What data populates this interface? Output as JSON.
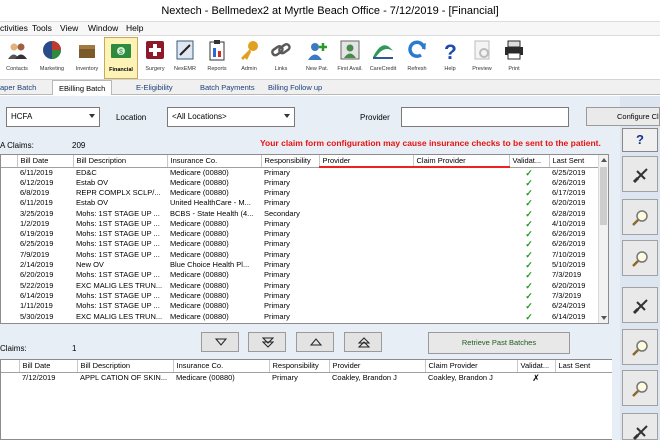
{
  "window": {
    "title": "Nextech - Bellmedex2 at Myrtle Beach Office - 7/12/2019 - [Financial]"
  },
  "menu": [
    "ctivities",
    "Tools",
    "View",
    "Window",
    "Help"
  ],
  "toolbar": [
    {
      "label": "Patients",
      "icon": "patients-icon",
      "color": "#3a6bb0"
    },
    {
      "label": "Contacts",
      "icon": "contacts-icon",
      "color": "#4a4a4a"
    },
    {
      "label": "Marketing",
      "icon": "marketing-pie-icon",
      "color": "#c0392b"
    },
    {
      "label": "Inventory",
      "icon": "inventory-icon",
      "color": "#7a5a2a"
    },
    {
      "label": "Financial",
      "icon": "financial-money-icon",
      "color": "#2e8b3e",
      "active": true
    },
    {
      "label": "Surgery",
      "icon": "surgery-cross-icon",
      "color": "#8c1a2a"
    },
    {
      "label": "NexEMR",
      "icon": "nexemr-icon",
      "color": "#3a5a7a"
    },
    {
      "label": "Reports",
      "icon": "reports-clipboard-icon",
      "color": "#2a4a9a"
    },
    {
      "label": "Admin",
      "icon": "admin-key-icon",
      "color": "#e0a020"
    },
    {
      "label": "Links",
      "icon": "links-chain-icon",
      "color": "#5a5a5a"
    },
    {
      "label": "New Pat.",
      "icon": "new-patient-icon",
      "color": "#3a7ac0"
    },
    {
      "label": "First Avail.",
      "icon": "first-available-icon",
      "color": "#4a8a4a"
    },
    {
      "label": "CareCredit",
      "icon": "carecredit-icon",
      "color": "#2e9a5a"
    },
    {
      "label": "Refresh",
      "icon": "refresh-icon",
      "color": "#2a7ad0"
    },
    {
      "label": "Help",
      "icon": "help-icon",
      "color": "#1a4ab0"
    },
    {
      "label": "Preview",
      "icon": "preview-icon",
      "color": "#bbbbbb"
    },
    {
      "label": "Print",
      "icon": "print-icon",
      "color": "#2a2a2a"
    }
  ],
  "subtabs": [
    "aper Batch",
    "EBilling Batch",
    "E-Eligibility",
    "Batch Payments",
    "Billing Follow up"
  ],
  "filters": {
    "form": "HCFA",
    "location_label": "Location",
    "location": "<All Locations>",
    "provider_label": "Provider",
    "provider": "",
    "configure": "Configure Claim"
  },
  "warning": "Your claim form configuration may cause insurance checks to be sent to the patient.",
  "top_grid": {
    "count_label": "A Claims:",
    "count": "209",
    "columns": [
      "Bill Date",
      "Bill Description",
      "Insurance Co.",
      "Responsibility",
      "Provider",
      "Claim Provider",
      "Validat...",
      "Last Sent"
    ],
    "rows": [
      [
        "6/11/2019",
        "ED&C",
        "Medicare (00880)",
        "Primary",
        "",
        "",
        "✓",
        "6/25/2019"
      ],
      [
        "6/12/2019",
        "Estab OV",
        "Medicare (00880)",
        "Primary",
        "",
        "",
        "✓",
        "6/26/2019"
      ],
      [
        "6/8/2019",
        "REPR COMPLX SCLP/...",
        "Medicare (00880)",
        "Primary",
        "",
        "",
        "✓",
        "6/17/2019"
      ],
      [
        "6/11/2019",
        "Estab OV",
        "United HealthCare - M...",
        "Primary",
        "",
        "",
        "✓",
        "6/20/2019"
      ],
      [
        "3/25/2019",
        "Mohs: 1ST STAGE UP ...",
        "BCBS - State Health (4...",
        "Secondary",
        "",
        "",
        "✓",
        "6/28/2019"
      ],
      [
        "1/2/2019",
        "Mohs: 1ST STAGE UP ...",
        "Medicare (00880)",
        "Primary",
        "",
        "",
        "✓",
        "4/10/2019"
      ],
      [
        "6/19/2019",
        "Mohs: 1ST STAGE UP ...",
        "Medicare (00880)",
        "Primary",
        "",
        "",
        "✓",
        "6/26/2019"
      ],
      [
        "6/25/2019",
        "Mohs: 1ST STAGE UP ...",
        "Medicare (00880)",
        "Primary",
        "",
        "",
        "✓",
        "6/26/2019"
      ],
      [
        "7/9/2019",
        "Mohs: 1ST STAGE UP ...",
        "Medicare (00880)",
        "Primary",
        "",
        "",
        "✓",
        "7/10/2019"
      ],
      [
        "2/14/2019",
        "New OV",
        "Blue Choice Health Pl...",
        "Primary",
        "",
        "",
        "✓",
        "5/10/2019"
      ],
      [
        "6/20/2019",
        "Mohs: 1ST STAGE UP ...",
        "Medicare (00880)",
        "Primary",
        "",
        "",
        "✓",
        "7/3/2019"
      ],
      [
        "5/22/2019",
        "EXC MALIG LES TRUN...",
        "Medicare (00880)",
        "Primary",
        "",
        "",
        "✓",
        "6/20/2019"
      ],
      [
        "6/14/2019",
        "Mohs: 1ST STAGE UP ...",
        "Medicare (00880)",
        "Primary",
        "",
        "",
        "✓",
        "7/3/2019"
      ],
      [
        "1/11/2019",
        "Mohs: 1ST STAGE UP ...",
        "Medicare (00880)",
        "Primary",
        "",
        "",
        "✓",
        "6/24/2019"
      ],
      [
        "5/30/2019",
        "EXC MALIG LES TRUN...",
        "Medicare (00880)",
        "Primary",
        "",
        "",
        "✓",
        "6/14/2019"
      ]
    ]
  },
  "retrieve_button": "Retrieve Past Batches",
  "bottom_grid": {
    "count_label": "Claims:",
    "count": "1",
    "columns": [
      "Bill Date",
      "Bill Description",
      "Insurance Co.",
      "Responsibility",
      "Provider",
      "Claim Provider",
      "Validat...",
      "Last Sent"
    ],
    "rows": [
      [
        "7/12/2019",
        "APPL CATION OF SKIN...",
        "Medicare (00880)",
        "Primary",
        "Coakley, Brandon J",
        "Coakley, Brandon J",
        "✗",
        ""
      ]
    ]
  },
  "side_buttons": [
    "unselect-icon",
    "search-icon",
    "search-icon",
    "unselect-icon",
    "search-icon",
    "search-icon",
    "unselect-icon"
  ],
  "help_label": "?",
  "colors": {
    "warning": "#e8130e",
    "check": "#1e9a1e",
    "background": "#e8eef6"
  }
}
